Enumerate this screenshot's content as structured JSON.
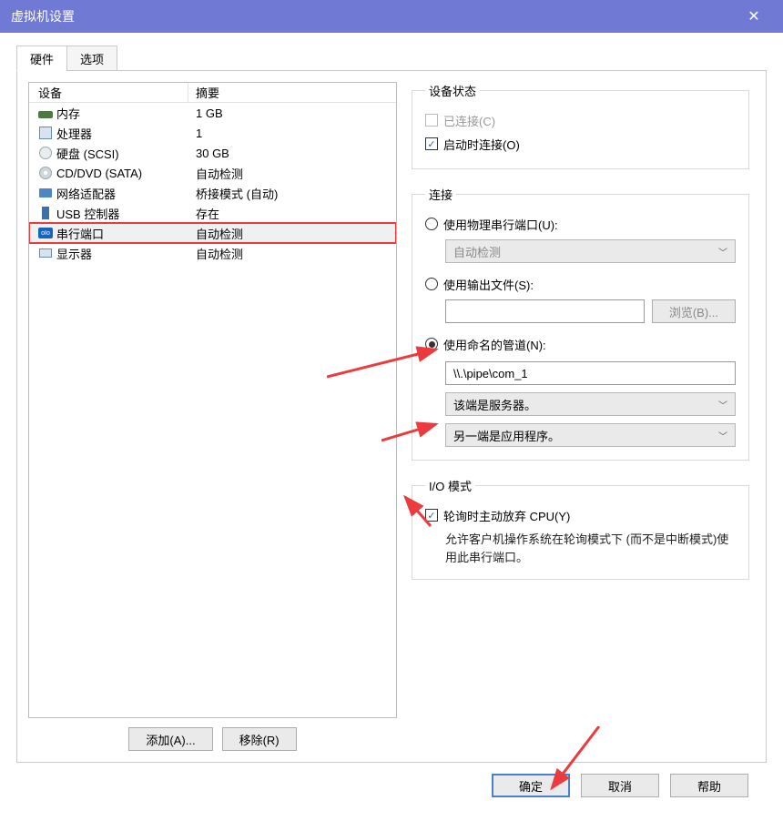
{
  "titlebar": {
    "title": "虚拟机设置"
  },
  "tabs": {
    "hardware": "硬件",
    "options": "选项"
  },
  "device_table": {
    "headers": {
      "device": "设备",
      "summary": "摘要"
    },
    "rows": [
      {
        "name": "内存",
        "summary": "1 GB",
        "icon": "mem"
      },
      {
        "name": "处理器",
        "summary": "1",
        "icon": "cpu"
      },
      {
        "name": "硬盘 (SCSI)",
        "summary": "30 GB",
        "icon": "disk"
      },
      {
        "name": "CD/DVD (SATA)",
        "summary": "自动检测",
        "icon": "cd"
      },
      {
        "name": "网络适配器",
        "summary": "桥接模式 (自动)",
        "icon": "net"
      },
      {
        "name": "USB 控制器",
        "summary": "存在",
        "icon": "usb"
      },
      {
        "name": "串行端口",
        "summary": "自动检测",
        "icon": "serial",
        "selected": true
      },
      {
        "name": "显示器",
        "summary": "自动检测",
        "icon": "display"
      }
    ]
  },
  "left_buttons": {
    "add": "添加(A)...",
    "remove": "移除(R)"
  },
  "device_status": {
    "legend": "设备状态",
    "connected": "已连接(C)",
    "connect_on_start": "启动时连接(O)"
  },
  "connection": {
    "legend": "连接",
    "use_physical": "使用物理串行端口(U):",
    "physical_value": "自动检测",
    "use_output": "使用输出文件(S):",
    "browse": "浏览(B)...",
    "use_named_pipe": "使用命名的管道(N):",
    "pipe_path": "\\\\.\\pipe\\com_1",
    "end_server": "该端是服务器。",
    "other_end_app": "另一端是应用程序。"
  },
  "io_mode": {
    "legend": "I/O 模式",
    "yield_cpu": "轮询时主动放弃 CPU(Y)",
    "desc": "允许客户机操作系统在轮询模式下 (而不是中断模式)使用此串行端口。"
  },
  "footer": {
    "ok": "确定",
    "cancel": "取消",
    "help": "帮助"
  }
}
